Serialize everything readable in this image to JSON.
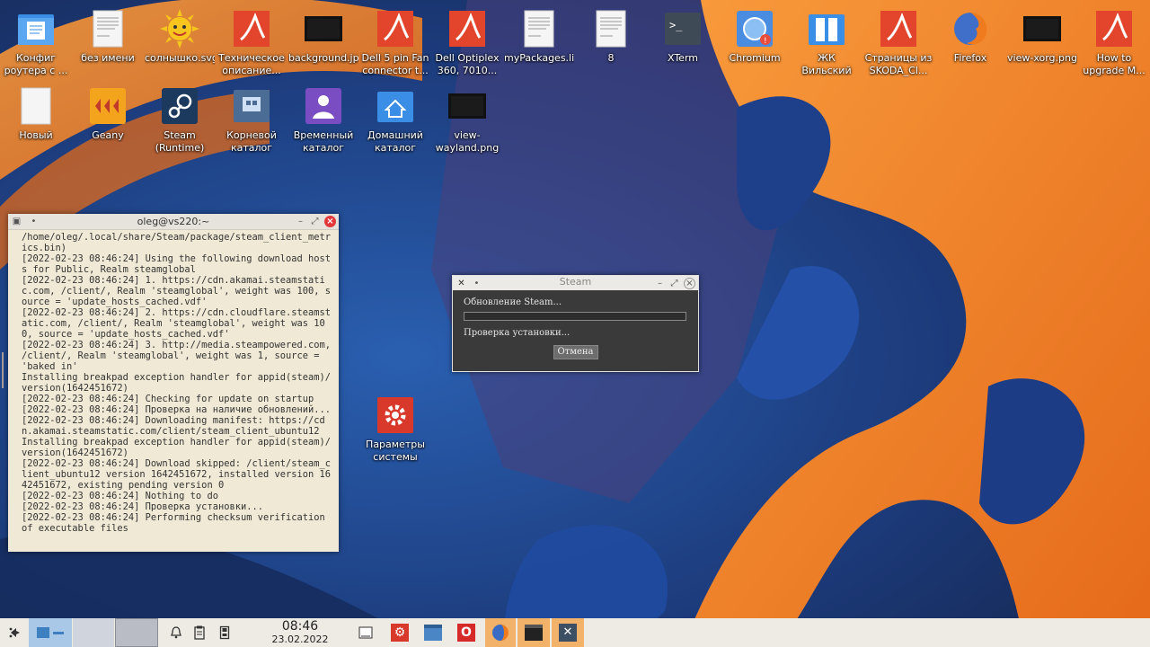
{
  "colors": {
    "accent_orange": "#ef7b20",
    "steam_dialog_bg": "#3a3a3a",
    "terminal_bg": "#efe9d5",
    "taskbar_bg": "#eeebe4",
    "close_red": "#e2383c"
  },
  "desktop_icons": [
    {
      "label": "Конфиг роутера с ...",
      "icon": "folder-documents-icon"
    },
    {
      "label": "без имени",
      "icon": "text-file-icon"
    },
    {
      "label": "солнышко.svg",
      "icon": "sun-image-icon"
    },
    {
      "label": "Техническое описание...",
      "icon": "pdf-file-icon"
    },
    {
      "label": "background.jpg",
      "icon": "image-file-icon"
    },
    {
      "label": "Dell 5 pin Fan connector t...",
      "icon": "pdf-file-icon"
    },
    {
      "label": "Dell Optiplex 360, 7010...",
      "icon": "pdf-file-icon"
    },
    {
      "label": "myPackages.list",
      "icon": "text-file-icon"
    },
    {
      "label": "8",
      "icon": "text-file-icon"
    },
    {
      "label": "XTerm",
      "icon": "terminal-icon"
    },
    {
      "label": "Chromium",
      "icon": "chromium-icon"
    },
    {
      "label": "ЖК Вильский",
      "icon": "folder-icon"
    },
    {
      "label": "Страницы из SKODA_Cl...",
      "icon": "pdf-file-icon"
    },
    {
      "label": "Firefox",
      "icon": "firefox-icon"
    },
    {
      "label": "view-xorg.png",
      "icon": "image-file-icon"
    },
    {
      "label": "How to upgrade M...",
      "icon": "pdf-file-icon"
    },
    {
      "label": "Новый",
      "icon": "blank-file-icon"
    },
    {
      "label": "Geany",
      "icon": "geany-icon"
    },
    {
      "label": "Steam (Runtime)",
      "icon": "steam-icon"
    },
    {
      "label": "Корневой каталог",
      "icon": "root-folder-icon"
    },
    {
      "label": "Временный каталог",
      "icon": "temp-folder-icon"
    },
    {
      "label": "Домашний каталог",
      "icon": "home-folder-icon"
    },
    {
      "label": "view-wayland.png",
      "icon": "image-file-icon"
    },
    {
      "label": "Параметры системы",
      "icon": "settings-icon"
    }
  ],
  "terminal": {
    "title": "oleg@vs220:~",
    "lines": [
      "/home/oleg/.local/share/Steam/package/steam_client_metrics.bin)",
      "[2022-02-23 08:46:24] Using the following download hosts for Public, Realm steamglobal",
      "[2022-02-23 08:46:24] 1. https://cdn.akamai.steamstatic.com, /client/, Realm 'steamglobal', weight was 100, source = 'update_hosts_cached.vdf'",
      "[2022-02-23 08:46:24] 2. https://cdn.cloudflare.steamstatic.com, /client/, Realm 'steamglobal', weight was 100, source = 'update_hosts_cached.vdf'",
      "[2022-02-23 08:46:24] 3. http://media.steampowered.com, /client/, Realm 'steamglobal', weight was 1, source = 'baked in'",
      "Installing breakpad exception handler for appid(steam)/version(1642451672)",
      "[2022-02-23 08:46:24] Checking for update on startup",
      "[2022-02-23 08:46:24] Проверка на наличие обновлений...",
      "[2022-02-23 08:46:24] Downloading manifest: https://cdn.akamai.steamstatic.com/client/steam_client_ubuntu12",
      "Installing breakpad exception handler for appid(steam)/version(1642451672)",
      "[2022-02-23 08:46:24] Download skipped: /client/steam_client_ubuntu12 version 1642451672, installed version 1642451672, existing pending version 0",
      "[2022-02-23 08:46:24] Nothing to do",
      "[2022-02-23 08:46:24] Проверка установки...",
      "[2022-02-23 08:46:24] Performing checksum verification of executable files"
    ],
    "cursor": "_"
  },
  "steam_dialog": {
    "title": "Steam",
    "status": "Обновление Steam...",
    "progress": 0.0,
    "substatus": "Проверка установки...",
    "cancel_label": "Отмена"
  },
  "taskbar": {
    "time": "08:46",
    "date": "23.02.2022"
  }
}
